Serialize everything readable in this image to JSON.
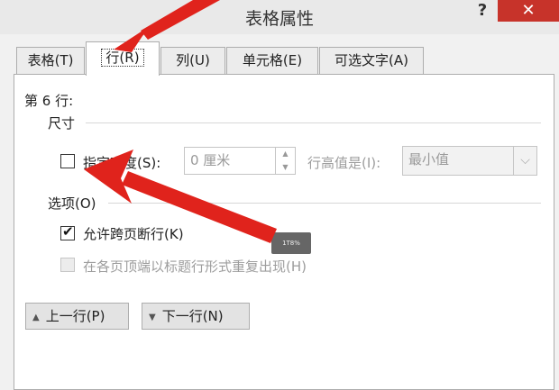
{
  "window": {
    "title": "表格属性",
    "help_label": "?",
    "close_label": "✕"
  },
  "tabs": [
    {
      "label": "表格(T)"
    },
    {
      "label": "行(R)"
    },
    {
      "label": "列(U)"
    },
    {
      "label": "单元格(E)"
    },
    {
      "label": "可选文字(A)"
    }
  ],
  "row_panel": {
    "row_label": "第 6 行:",
    "size_group": "尺寸",
    "height_checkbox_label": "指定高度(S):",
    "height_value": "0 厘米",
    "row_height_is_label": "行高值是(I):",
    "row_height_mode": "最小值",
    "options_group": "选项(O)",
    "allow_break_label": "允许跨页断行(K)",
    "repeat_header_label": "在各页顶端以标题行形式重复出现(H)",
    "prev_row_button": "上一行(P)",
    "next_row_button": "下一行(N)"
  },
  "overlay": {
    "tooltip_text": "1T8%",
    "arrow_color": "#e0231c"
  }
}
